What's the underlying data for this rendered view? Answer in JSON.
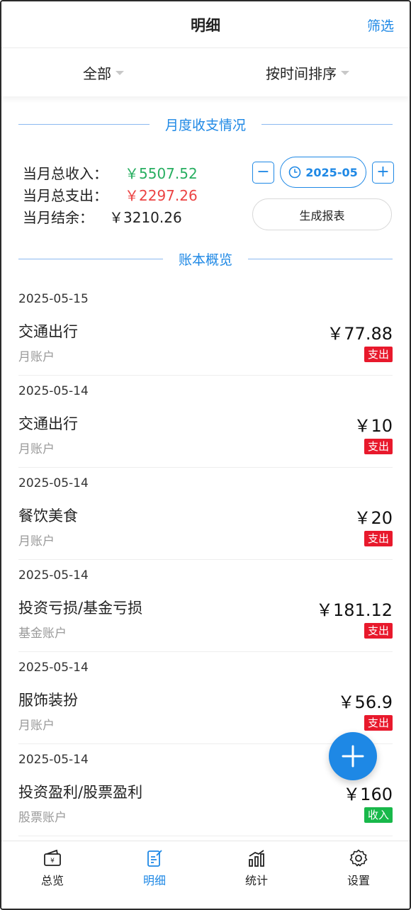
{
  "header": {
    "title": "明细",
    "filter_label": "筛选"
  },
  "dropdowns": {
    "scope": "全部",
    "sort": "按时间排序"
  },
  "monthly": {
    "section_title": "月度收支情况",
    "income_label": "当月总收入：",
    "income_value": "￥5507.52",
    "expense_label": "当月总支出：",
    "expense_value": "￥2297.26",
    "balance_label": "当月结余：",
    "balance_value": "￥3210.26",
    "month": "2025-05",
    "minus": "−",
    "plus": "+",
    "report_label": "生成报表"
  },
  "ledger": {
    "section_title": "账本概览",
    "entries": [
      {
        "date": "2025-05-15",
        "category": "交通出行",
        "account": "月账户",
        "amount": "￥77.88",
        "type": "支出"
      },
      {
        "date": "2025-05-14",
        "category": "交通出行",
        "account": "月账户",
        "amount": "￥10",
        "type": "支出"
      },
      {
        "date": "2025-05-14",
        "category": "餐饮美食",
        "account": "月账户",
        "amount": "￥20",
        "type": "支出"
      },
      {
        "date": "2025-05-14",
        "category": "投资亏损/基金亏损",
        "account": "基金账户",
        "amount": "￥181.12",
        "type": "支出"
      },
      {
        "date": "2025-05-14",
        "category": "服饰装扮",
        "account": "月账户",
        "amount": "￥56.9",
        "type": "支出"
      },
      {
        "date": "2025-05-14",
        "category": "投资盈利/股票盈利",
        "account": "股票账户",
        "amount": "￥160",
        "type": "收入"
      }
    ]
  },
  "nav": [
    {
      "label": "总览",
      "icon": "wallet-icon"
    },
    {
      "label": "明细",
      "icon": "detail-icon"
    },
    {
      "label": "统计",
      "icon": "chart-icon"
    },
    {
      "label": "设置",
      "icon": "gear-icon"
    }
  ],
  "colors": {
    "accent": "#1e88e5",
    "income": "#27ae60",
    "expense": "#ec4343",
    "tag_expense": "#e8192c",
    "tag_income": "#18b84a"
  }
}
